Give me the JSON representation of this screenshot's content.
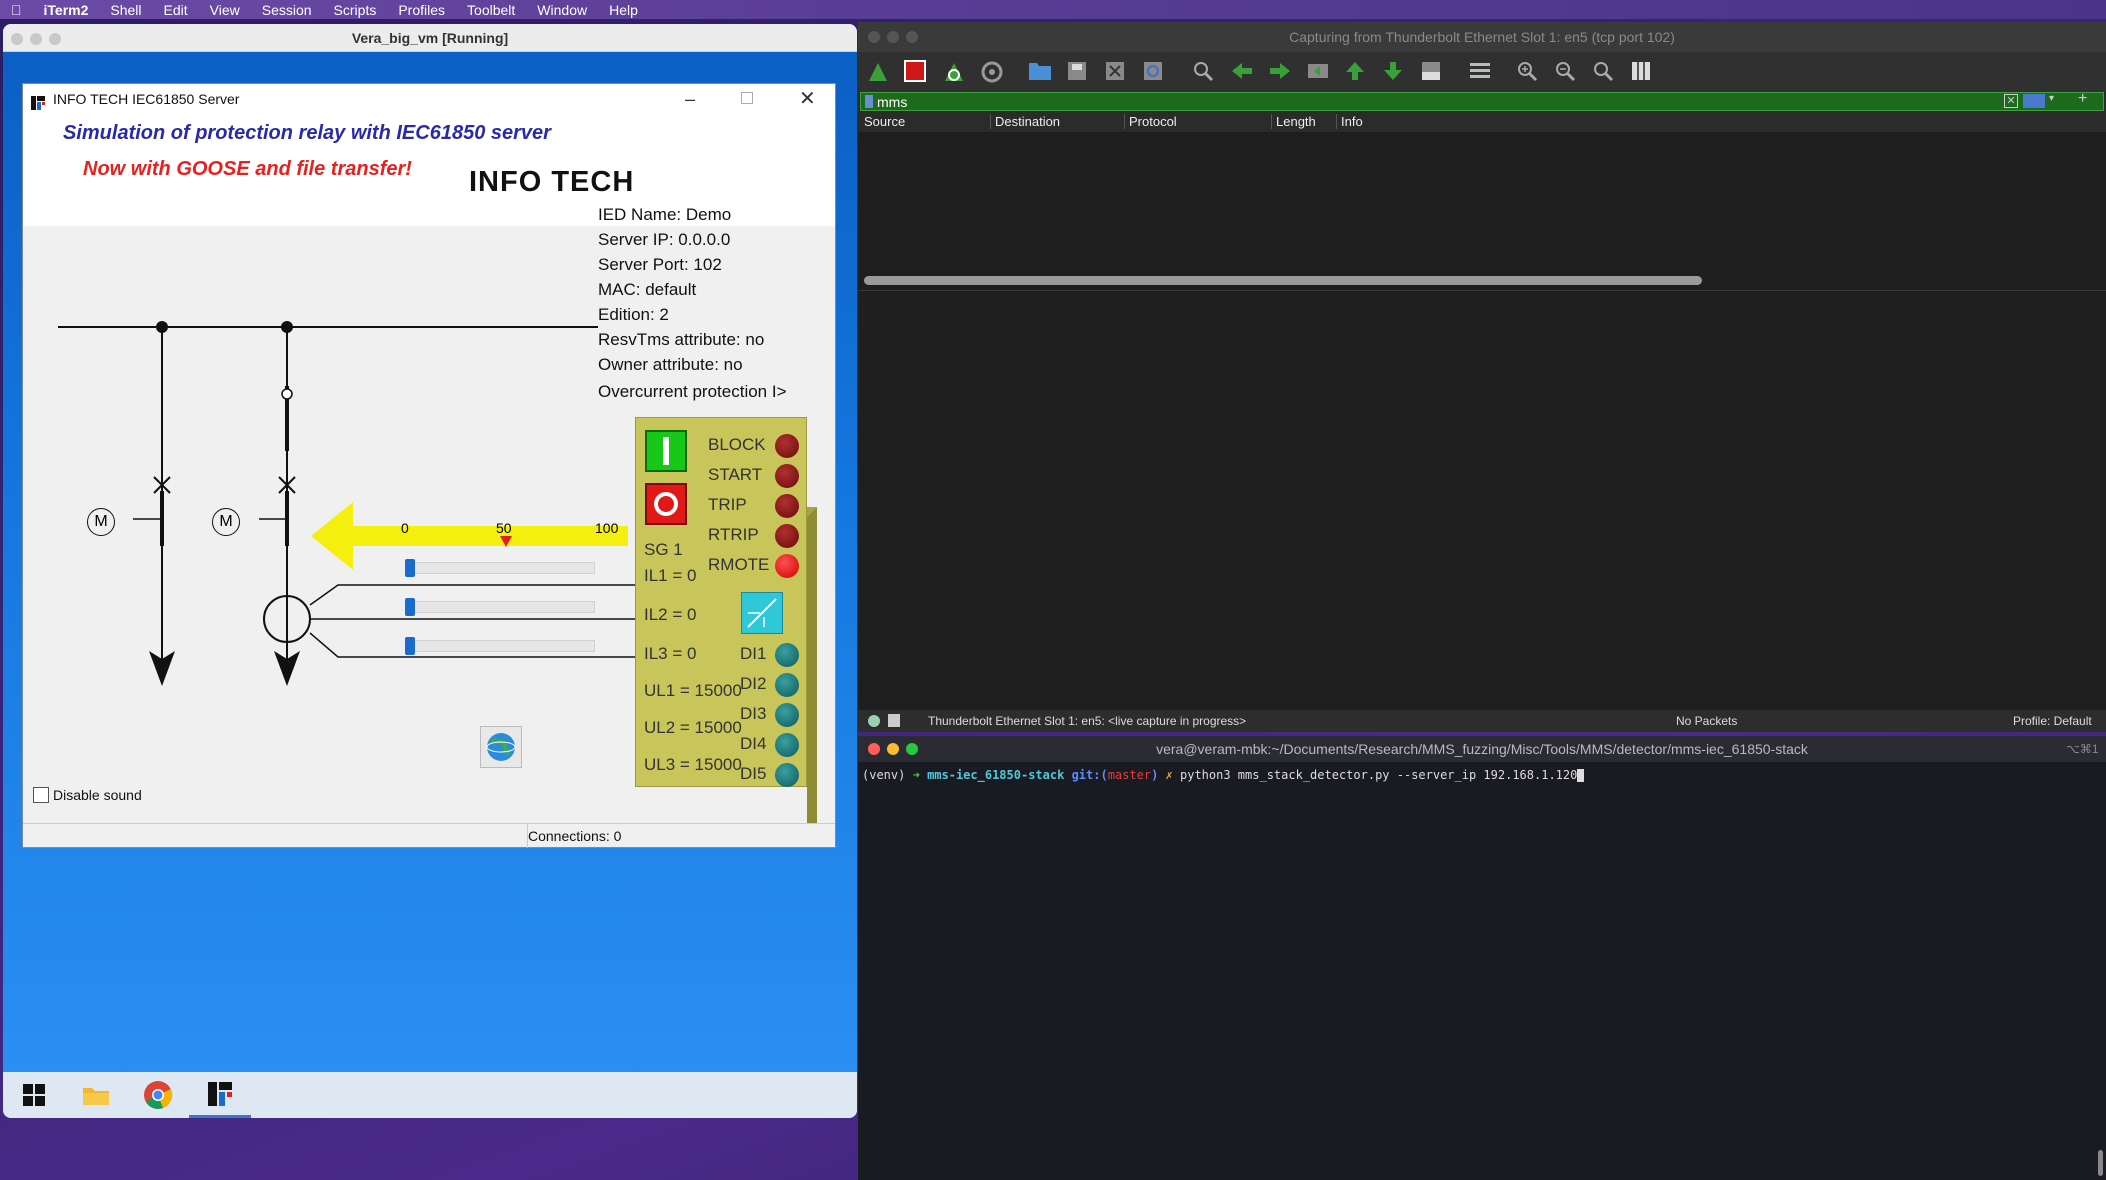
{
  "menubar": {
    "apple_icon": "apple-icon",
    "app_name": "iTerm2",
    "items": [
      "Shell",
      "Edit",
      "View",
      "Session",
      "Scripts",
      "Profiles",
      "Toolbelt",
      "Window",
      "Help"
    ]
  },
  "vm_window": {
    "title": "Vera_big_vm [Running]"
  },
  "app": {
    "title": "INFO TECH IEC61850 Server",
    "sim_title": "Simulation of protection relay with IEC61850 server",
    "goose_text": "Now with GOOSE and file transfer!",
    "logo": "INFO TECH",
    "info": {
      "ied_name": "IED Name: Demo",
      "server_ip": "Server IP: 0.0.0.0",
      "server_port": "Server Port: 102",
      "mac": "MAC: default",
      "edition": "Edition: 2",
      "resv": "ResvTms attribute: no",
      "owner": "Owner attribute: no",
      "overcurrent": "Overcurrent protection I>"
    },
    "scale": {
      "s0": "0",
      "s50": "50",
      "s100": "100"
    },
    "sliders": [
      0,
      0,
      0
    ],
    "motor_label": "M",
    "relay": {
      "block": "BLOCK",
      "start": "START",
      "trip": "TRIP",
      "rtrip": "RTRIP",
      "rmote": "RMOTE",
      "sg": "SG 1",
      "il1": "IL1 = 0",
      "il2": "IL2 = 0",
      "il3": "IL3 = 0",
      "ul1": "UL1 = 15000",
      "ul2": "UL2 = 15000",
      "ul3": "UL3 = 15000",
      "di1": "DI1",
      "di2": "DI2",
      "di3": "DI3",
      "di4": "DI4",
      "di5": "DI5"
    },
    "disable_sound": "Disable sound",
    "connections": "Connections: 0"
  },
  "wireshark": {
    "title": "Capturing from Thunderbolt Ethernet Slot 1: en5 (tcp port 102)",
    "filter": "mms",
    "columns": [
      "Source",
      "Destination",
      "Protocol",
      "Length",
      "Info"
    ],
    "status_interface": "Thunderbolt Ethernet Slot 1: en5: <live capture in progress>",
    "status_packets": "No Packets",
    "status_profile": "Profile: Default"
  },
  "terminal": {
    "title": "vera@veram-mbk:~/Documents/Research/MMS_fuzzing/Misc/Tools/MMS/detector/mms-iec_61850-stack",
    "shortcut": "⌥⌘1",
    "venv": "(venv)",
    "arrow": "➜",
    "dir": "mms-iec_61850-stack",
    "git_label": "git:(",
    "branch": "master",
    "git_close": ")",
    "dirty": "✗",
    "command": "python3 mms_stack_detector.py --server_ip 192.168.1.120"
  },
  "colors": {
    "sim_title": "#2a2aa8",
    "goose": "#e8201e",
    "relay_body": "#c8c65a",
    "filter_bg": "#1d6a1d"
  }
}
